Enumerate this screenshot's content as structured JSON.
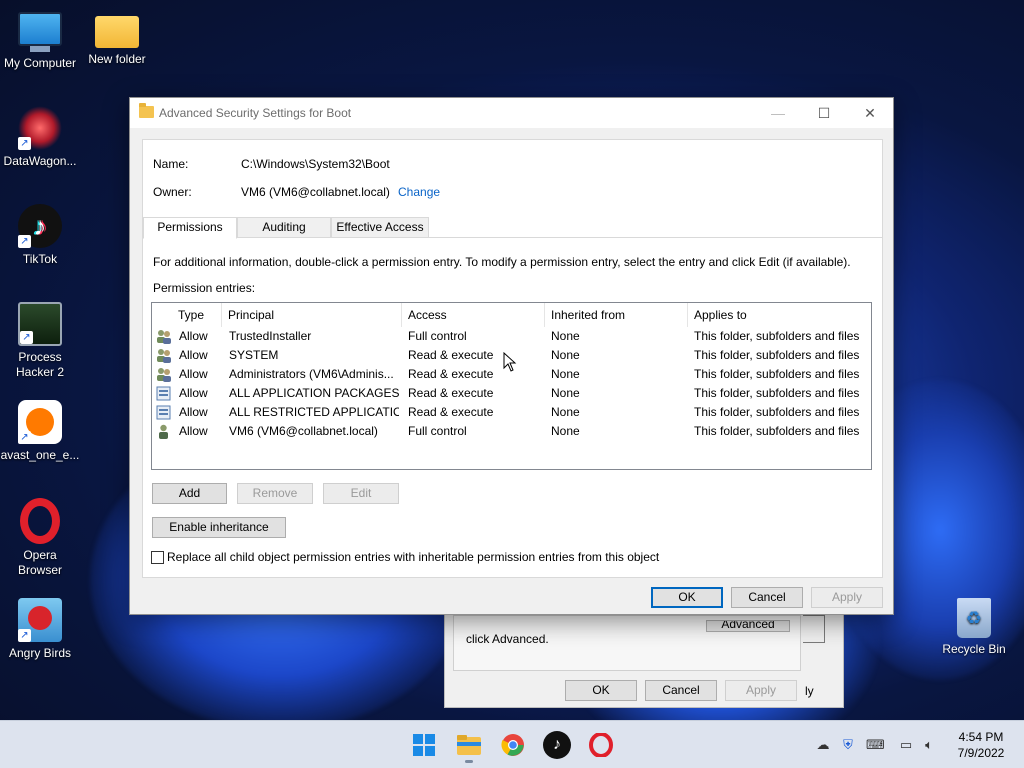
{
  "desktop": {
    "icons": [
      {
        "label": "My Computer"
      },
      {
        "label": "New folder"
      },
      {
        "label": "DataWagon..."
      },
      {
        "label": "TikTok"
      },
      {
        "label": "Process\nHacker 2"
      },
      {
        "label": "avast_one_e..."
      },
      {
        "label": "Opera\nBrowser"
      },
      {
        "label": "Angry Birds"
      },
      {
        "label": "Recycle Bin"
      }
    ]
  },
  "back_dialog": {
    "text": "click Advanced.",
    "advanced_label": "Advanced",
    "ok_label": "OK",
    "cancel_label": "Cancel",
    "apply_label": "Apply",
    "apply_partial": "ly"
  },
  "dialog": {
    "title": "Advanced Security Settings for Boot",
    "name_label": "Name:",
    "name_value": "C:\\Windows\\System32\\Boot",
    "owner_label": "Owner:",
    "owner_value": "VM6 (VM6@collabnet.local)",
    "change_link": "Change",
    "tabs": [
      {
        "label": "Permissions",
        "active": true
      },
      {
        "label": "Auditing",
        "active": false
      },
      {
        "label": "Effective Access",
        "active": false
      }
    ],
    "info_text": "For additional information, double-click a permission entry. To modify a permission entry, select the entry and click Edit (if available).",
    "entries_label": "Permission entries:",
    "columns": [
      "Type",
      "Principal",
      "Access",
      "Inherited from",
      "Applies to"
    ],
    "rows": [
      {
        "icon": "users-icon",
        "type": "Allow",
        "principal": "TrustedInstaller",
        "access": "Full control",
        "inherited": "None",
        "applies": "This folder, subfolders and files"
      },
      {
        "icon": "users-icon",
        "type": "Allow",
        "principal": "SYSTEM",
        "access": "Read & execute",
        "inherited": "None",
        "applies": "This folder, subfolders and files"
      },
      {
        "icon": "users-icon",
        "type": "Allow",
        "principal": "Administrators (VM6\\Adminis...",
        "access": "Read & execute",
        "inherited": "None",
        "applies": "This folder, subfolders and files"
      },
      {
        "icon": "package-icon",
        "type": "Allow",
        "principal": "ALL APPLICATION PACKAGES",
        "access": "Read & execute",
        "inherited": "None",
        "applies": "This folder, subfolders and files"
      },
      {
        "icon": "package-icon",
        "type": "Allow",
        "principal": "ALL RESTRICTED APPLICATIO...",
        "access": "Read & execute",
        "inherited": "None",
        "applies": "This folder, subfolders and files"
      },
      {
        "icon": "user-icon",
        "type": "Allow",
        "principal": "VM6 (VM6@collabnet.local)",
        "access": "Full control",
        "inherited": "None",
        "applies": "This folder, subfolders and files"
      }
    ],
    "add_label": "Add",
    "remove_label": "Remove",
    "edit_label": "Edit",
    "enable_inheritance_label": "Enable inheritance",
    "replace_checkbox_label": "Replace all child object permission entries with inheritable permission entries from this object",
    "replace_checked": false,
    "ok_label": "OK",
    "cancel_label": "Cancel",
    "apply_label": "Apply"
  },
  "taskbar": {
    "apps": [
      "start-icon",
      "file-explorer-icon",
      "chrome-icon",
      "tiktok-icon",
      "opera-icon"
    ],
    "time": "4:54 PM",
    "date": "7/9/2022"
  },
  "colors": {
    "accent": "#0067c0",
    "link": "#0a64c8",
    "opera_red": "#e0202b"
  }
}
